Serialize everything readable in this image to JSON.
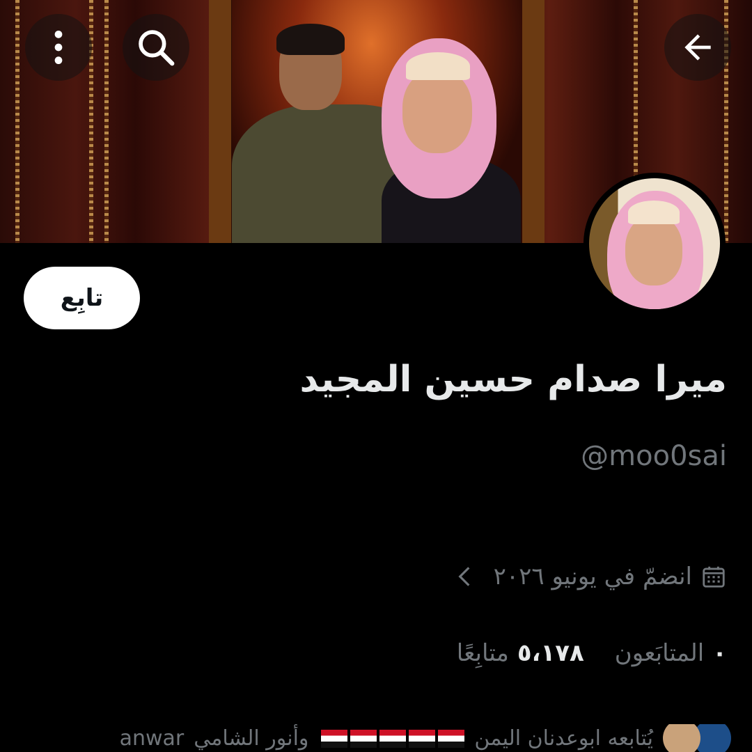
{
  "header": {
    "back_icon": "arrow-left-icon",
    "search_icon": "search-icon",
    "more_icon": "more-vertical-icon"
  },
  "profile": {
    "display_name": "ميرا صدام حسين المجيد",
    "handle": "@moo0sai",
    "follow_label": "تابِع",
    "joined_text": "انضمّ في يونيو ٢٠٢٦",
    "following_count": "٠",
    "following_label": "المتابَعون",
    "followers_count": "٥،١٧٨",
    "followers_label": "متابِعًا",
    "followed_by_text": "يُتابعه ابوعدنان اليمن",
    "followed_by_second": "وأنور الشامي",
    "followed_by_third": "anwar"
  },
  "colors": {
    "background": "#000000",
    "primary_text": "#e7e9ea",
    "secondary_text": "#71767b",
    "follow_button_bg": "#ffffff"
  }
}
